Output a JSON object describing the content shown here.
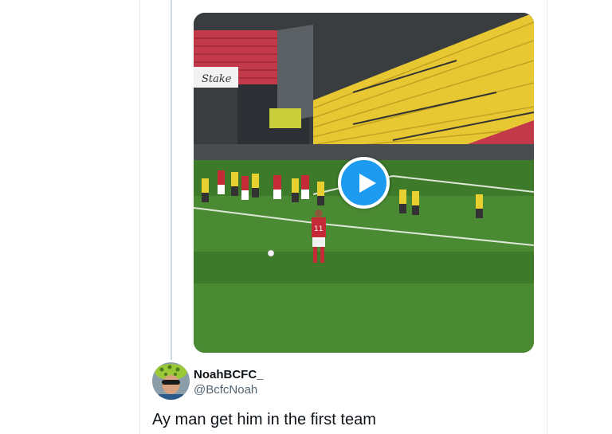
{
  "quoted_tweet": {
    "media": {
      "type": "video",
      "play_icon": "play-icon",
      "sponsor_board_text": "Stake",
      "player_shirt_number": "11"
    }
  },
  "reply": {
    "author": {
      "display_name": "NoahBCFC_",
      "handle": "@BcfcNoah",
      "avatar_icon": "avatar-photo"
    },
    "text": "Ay man get him in the first team"
  },
  "colors": {
    "accent": "#1d9bf0",
    "text_primary": "#0f1419",
    "text_secondary": "#536471",
    "border": "#e6ecf0"
  }
}
